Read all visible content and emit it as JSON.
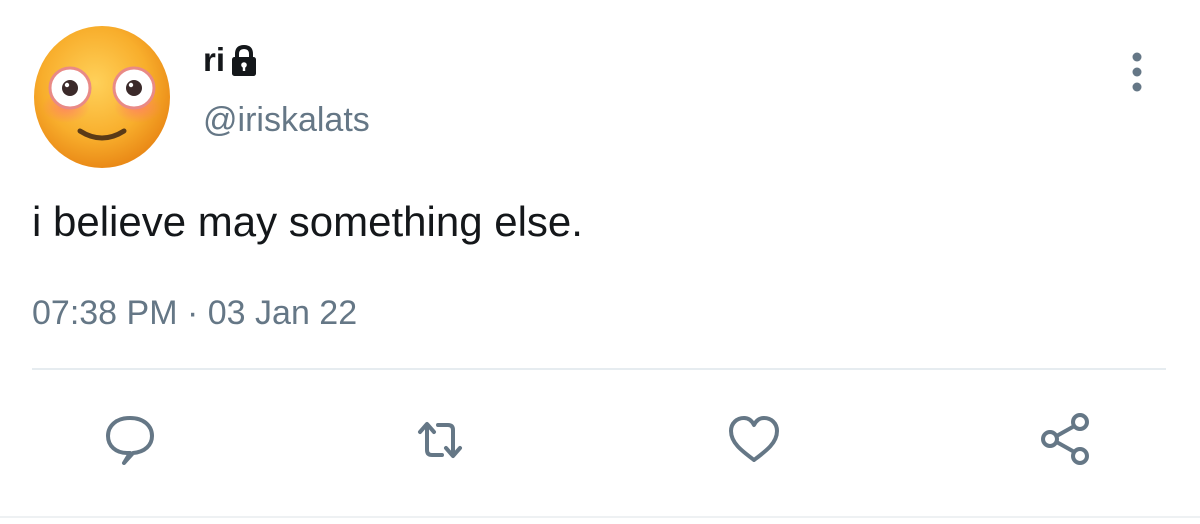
{
  "user": {
    "display_name": "ri",
    "handle": "@iriskalats",
    "avatar_icon": "flushed-face-emoji-avatar",
    "protected_icon": "lock-icon"
  },
  "tweet": {
    "text": "i believe may something else.",
    "time": "07:38 PM",
    "separator": "·",
    "date": "03 Jan 22"
  },
  "actions": {
    "reply_icon": "reply-icon",
    "retweet_icon": "retweet-icon",
    "like_icon": "heart-icon",
    "share_icon": "share-icon",
    "more_icon": "more-vertical-icon"
  },
  "colors": {
    "text_primary": "#14171a",
    "text_secondary": "#657786",
    "icon_color": "#657786",
    "divider": "#e6ecf0"
  }
}
